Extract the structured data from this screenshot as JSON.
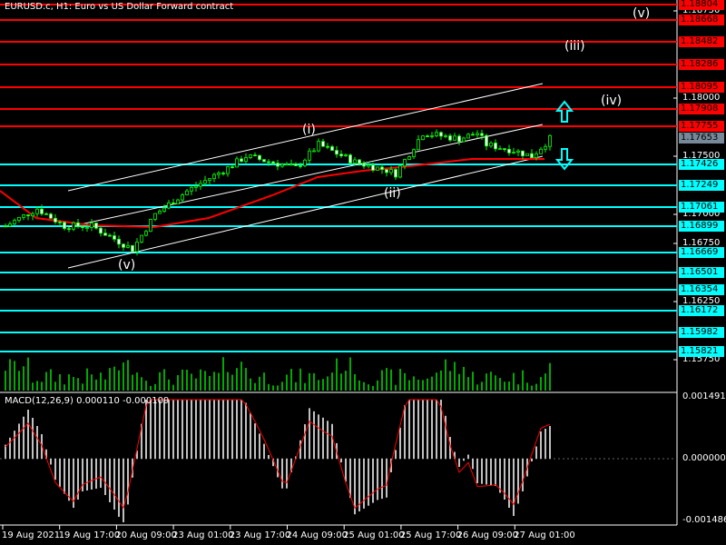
{
  "header": {
    "title": "EURUSD.c, H1:  Euro vs US Dollar Forward contract"
  },
  "macd": {
    "title": "MACD(12,26,9) 0.000110 -0.000109",
    "scale": [
      "0.001491",
      "0.000000",
      "-0.001486"
    ]
  },
  "colors": {
    "resistance": "#ff0000",
    "support": "#00ffff",
    "bid": "#778899",
    "candle": "#00ff00",
    "ma": "#ff0000",
    "volume": "#00aa00",
    "histogram": "#c0c0c0"
  },
  "price_grid": [
    "1.18750",
    "1.18000",
    "1.17500",
    "1.17000",
    "1.16750",
    "1.16250",
    "1.15750"
  ],
  "red_levels": [
    "1.18804",
    "1.18668",
    "1.18482",
    "1.18286",
    "1.18095",
    "1.17908",
    "1.17755"
  ],
  "bid": "1.17653",
  "cyan_levels": [
    "1.17426",
    "1.17249",
    "1.17061",
    "1.16899",
    "1.16669",
    "1.16501",
    "1.16354",
    "1.16172",
    "1.15982",
    "1.15821"
  ],
  "time_labels": [
    "19 Aug 2021",
    "19 Aug 17:00",
    "20 Aug 09:00",
    "23 Aug 01:00",
    "23 Aug 17:00",
    "24 Aug 09:00",
    "25 Aug 01:00",
    "25 Aug 17:00",
    "26 Aug 09:00",
    "27 Aug 01:00"
  ],
  "waves": [
    "(v)",
    "(i)",
    "(ii)",
    "(iii)",
    "(iv)",
    "(v)"
  ],
  "chart_data": {
    "type": "candlestick",
    "symbol": "EURUSD.c",
    "timeframe": "H1",
    "path_bars": [
      0,
      7,
      13,
      19,
      28,
      33,
      40,
      49,
      53,
      64,
      69,
      77,
      84,
      86,
      92,
      100,
      104,
      106,
      112,
      116,
      120
    ],
    "path_prices": [
      1.169,
      1.1705,
      1.169,
      1.169,
      1.167,
      1.17,
      1.172,
      1.174,
      1.175,
      1.174,
      1.176,
      1.1745,
      1.1738,
      1.1735,
      1.177,
      1.1765,
      1.177,
      1.176,
      1.1755,
      1.175,
      1.1765
    ],
    "ylim": [
      1.1545,
      1.1885
    ]
  }
}
